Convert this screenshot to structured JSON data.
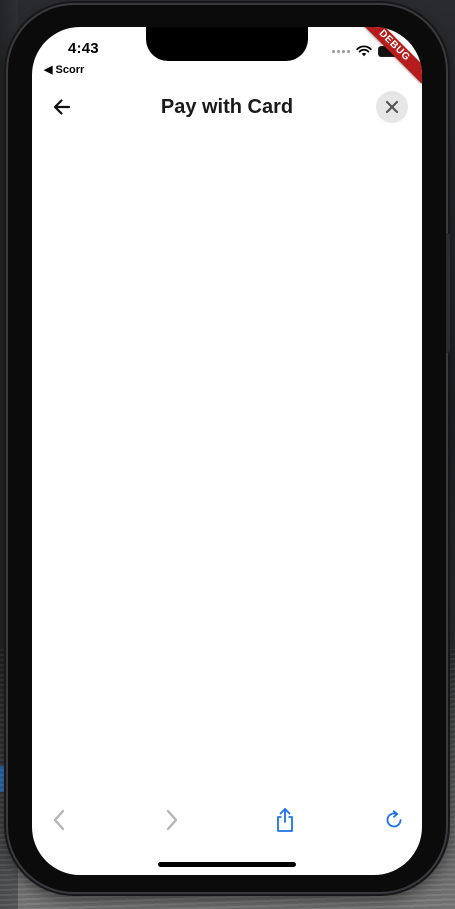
{
  "status_bar": {
    "time": "4:43",
    "back_app": "◀ Scorr"
  },
  "debug_banner": {
    "label": "DEBUG",
    "color": "#b71c1c"
  },
  "app_bar": {
    "title": "Pay with Card",
    "back_icon": "arrow-left-icon",
    "close_icon": "close-icon"
  },
  "toolbar": {
    "back_icon": "chevron-left-icon",
    "forward_icon": "chevron-right-icon",
    "share_icon": "share-icon",
    "reload_icon": "reload-icon",
    "accent_color": "#1a73e8",
    "disabled_color": "#b5b5b5"
  }
}
